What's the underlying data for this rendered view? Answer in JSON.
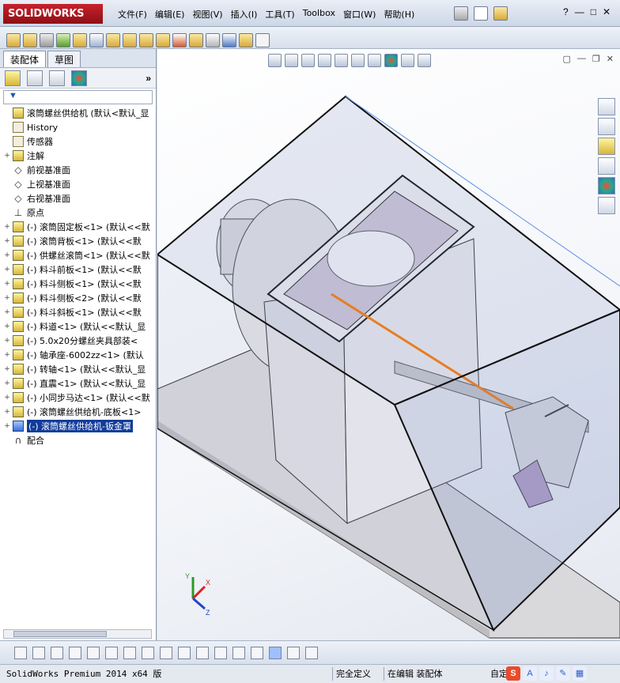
{
  "app": {
    "logo_text": "SOLIDWORKS"
  },
  "menu": {
    "items": [
      "文件(F)",
      "编辑(E)",
      "视图(V)",
      "插入(I)",
      "工具(T)",
      "Toolbox",
      "窗口(W)",
      "帮助(H)"
    ]
  },
  "window_controls": {
    "help": "?",
    "minimize": "—",
    "restore": "□",
    "close": "✕"
  },
  "panel": {
    "tabs": [
      "装配体",
      "草图"
    ],
    "expand": "»",
    "filter_symbol": "▼"
  },
  "tree": [
    {
      "twisty": "",
      "icon": "assembly-icon",
      "label": "滚筒螺丝供给机  (默认<默认_显"
    },
    {
      "twisty": "",
      "icon": "history-icon",
      "label": "History"
    },
    {
      "twisty": "",
      "icon": "sensor-icon",
      "label": "传感器"
    },
    {
      "twisty": "+",
      "icon": "annotation-icon",
      "label": "注解"
    },
    {
      "twisty": "",
      "icon": "plane-icon",
      "label": "前视基准面"
    },
    {
      "twisty": "",
      "icon": "plane-icon",
      "label": "上视基准面"
    },
    {
      "twisty": "",
      "icon": "plane-icon",
      "label": "右视基准面"
    },
    {
      "twisty": "",
      "icon": "origin-icon",
      "label": "原点"
    },
    {
      "twisty": "+",
      "icon": "part-icon",
      "label": "(-) 滚筒固定板<1> (默认<<默"
    },
    {
      "twisty": "+",
      "icon": "part-icon",
      "label": "(-) 滚筒背板<1> (默认<<默"
    },
    {
      "twisty": "+",
      "icon": "part-icon",
      "label": "(-) 供螺丝滚筒<1> (默认<<默"
    },
    {
      "twisty": "+",
      "icon": "part-icon",
      "label": "(-) 料斗前板<1> (默认<<默"
    },
    {
      "twisty": "+",
      "icon": "part-icon",
      "label": "(-) 料斗侧板<1> (默认<<默"
    },
    {
      "twisty": "+",
      "icon": "part-icon",
      "label": "(-) 料斗侧板<2> (默认<<默"
    },
    {
      "twisty": "+",
      "icon": "part-icon",
      "label": "(-) 料斗斜板<1> (默认<<默"
    },
    {
      "twisty": "+",
      "icon": "part-icon",
      "label": "(-) 料道<1> (默认<<默认_显"
    },
    {
      "twisty": "+",
      "icon": "subassembly-icon",
      "label": "(-) 5.0x20分螺丝夹具部装<"
    },
    {
      "twisty": "+",
      "icon": "part-icon",
      "label": "(-) 轴承座-6002zz<1> (默认"
    },
    {
      "twisty": "+",
      "icon": "part-icon",
      "label": "(-) 转轴<1> (默认<<默认_显"
    },
    {
      "twisty": "+",
      "icon": "part-icon",
      "label": "(-) 直震<1> (默认<<默认_显"
    },
    {
      "twisty": "+",
      "icon": "part-icon",
      "label": "(-) 小同步马达<1> (默认<<默"
    },
    {
      "twisty": "+",
      "icon": "part-icon",
      "label": "(-) 滚筒螺丝供给机-底板<1>"
    },
    {
      "twisty": "+",
      "icon": "part-icon-selected",
      "label": "(-) 滚筒螺丝供给机-钣金罩",
      "selected": true
    },
    {
      "twisty": "",
      "icon": "mate-icon",
      "label": "配合"
    }
  ],
  "status": {
    "app_version": "SolidWorks Premium 2014 x64 版",
    "defined": "完全定义",
    "editing": "在编辑 装配体",
    "custom": "自定",
    "ime": [
      "S",
      "A",
      "♪",
      "✎",
      "▦"
    ]
  },
  "triad": {
    "x": "X",
    "y": "Y",
    "z": "Z"
  },
  "colors": {
    "accent": "#c8212b",
    "selection": "#123c9a",
    "rail": "#ff7a00"
  }
}
